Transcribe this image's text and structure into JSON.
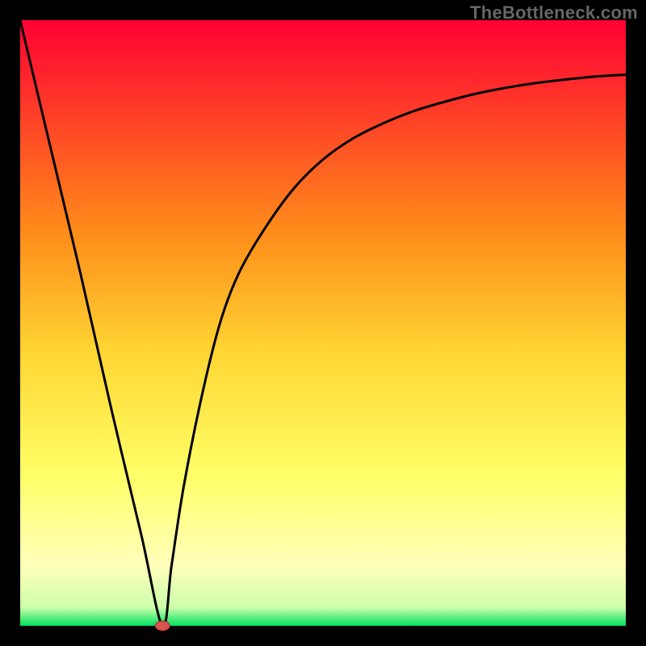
{
  "attribution": "TheBottleneck.com",
  "chart_data": {
    "type": "line",
    "title": "",
    "xlabel": "",
    "ylabel": "",
    "xlim": [
      0,
      100
    ],
    "ylim": [
      0,
      100
    ],
    "grid": false,
    "legend": false,
    "series": [
      {
        "name": "bottleneck-curve",
        "x": [
          0,
          5,
          10,
          15,
          20,
          23.5,
          25,
          27,
          30,
          33,
          36,
          40,
          45,
          50,
          55,
          60,
          65,
          70,
          75,
          80,
          85,
          90,
          95,
          100
        ],
        "values": [
          100,
          79,
          58,
          36,
          15,
          0,
          10,
          23,
          38,
          50,
          58,
          65,
          72,
          77,
          80.5,
          83,
          85,
          86.5,
          87.8,
          88.8,
          89.6,
          90.2,
          90.7,
          91
        ]
      }
    ],
    "marker": {
      "x": 23.5,
      "y": 0,
      "color": "#d9534f"
    },
    "gradient": {
      "top": "#ff0033",
      "mid_upper": "#ff8c1a",
      "mid": "#ffd633",
      "mid_lower": "#ffff66",
      "band": "#ffffbb",
      "bottom": "#00e060"
    },
    "frame": {
      "outer_size": 800,
      "border": 25,
      "inner_origin_x": 25,
      "inner_origin_y": 25,
      "inner_size": 750
    }
  }
}
